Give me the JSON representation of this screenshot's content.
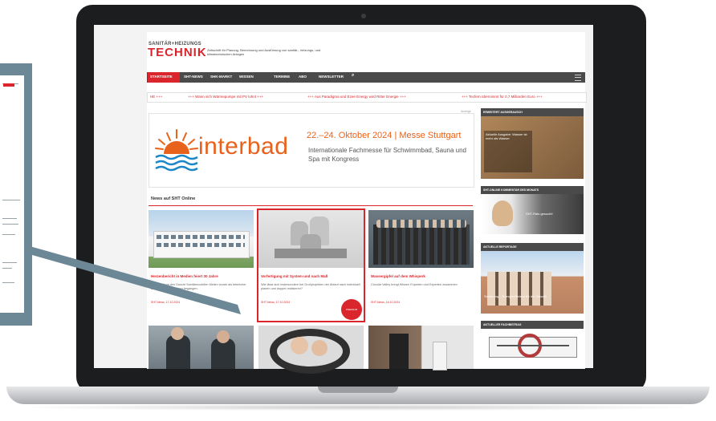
{
  "colors": {
    "brand": "#d9252b",
    "accent": "#e8621b",
    "nav": "#4a4a4a"
  },
  "site": {
    "logo_top": "SANITÄR+HEIZUNGS",
    "logo_main": "TECHNIK",
    "tagline": "Zeitschrift für Planung, Berechnung und Ausführung von sanitär-, heizungs- und klimatechnischen Anlagen"
  },
  "nav": {
    "items": [
      "STARTSEITE",
      "SHT-NEWS",
      "SHK-MARKT",
      "WISSEN",
      "TERMINE",
      "ABO",
      "NEWSLETTER"
    ],
    "search_icon": "search-icon",
    "menu_icon": "menu-icon"
  },
  "ticker": [
    "+++ Wann sich Wärmepumpe mit PV lohnt +++",
    "+++ Aus Paradigma und Ezee Energy wird Ritter Energie +++",
    "+++ Tecfern übernimmt für 0,7 Milliarden Euro +++"
  ],
  "ad": {
    "label": "Anzeige",
    "brand": "interbad",
    "date": "22.–24. Oktober 2024 | Messe Stuttgart",
    "subtitle": "Internationale Fachmesse für Schwimmbad, Sauna und Spa mit Kongress"
  },
  "news": {
    "section_title": "News auf SHT Online",
    "cards": [
      {
        "title": "Herzenbericht in Medien feiert 30 Jahre",
        "text": "Das Jubiläum des Duscht Sanitärmodellen Meilen wurde als feierlicher Unternehmensempfang begangen.",
        "meta": "SHT-News, 17.10.2024"
      },
      {
        "title": "Vorfertigung mit System und nach Maß",
        "text": "Wie lässt sich insbesondere bei Großprojekten der Ablauf nach individuell planen und doppel realisieren?",
        "meta": "SHT-News, 17.10.2024",
        "badge": "PREMIUM"
      },
      {
        "title": "Wassergipfel auf dem Whisperk",
        "text": "Circular Valley bringt Wissen Experten und Experten zusammen",
        "meta": "SHT-News, 16.10.2024"
      }
    ]
  },
  "sidebar": [
    {
      "title": "ERWEITERT AUSGERAUSCH",
      "text": "Aktuelle Ausgabe: Wasser ist mehr als Wasser"
    },
    {
      "title": "SHT-ONLINE KOMMENTAR DES MONATS",
      "text": "SHT-Rats gesucht!"
    },
    {
      "title": "AKTUELLE REPORTAGE",
      "text": "Sanierung – Energieeffizienz für die Zukunft"
    },
    {
      "title": "AKTUELLER FACHBEITRAG",
      "text": ""
    }
  ]
}
